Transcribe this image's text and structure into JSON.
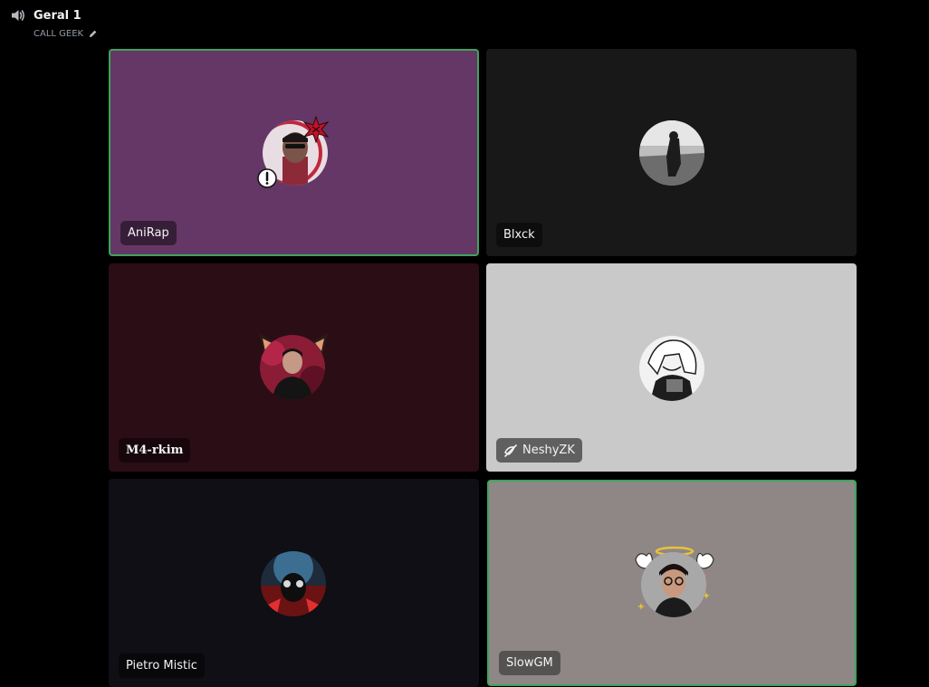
{
  "channel": {
    "name": "Geral 1",
    "subtitle": "CALL GEEK",
    "speaker_icon": "speaker-icon",
    "edit_icon": "pencil-icon"
  },
  "tiles": [
    {
      "name": "AniRap",
      "background": "#653766",
      "speaking": true
    },
    {
      "name": "Blxck",
      "background": "#181818",
      "speaking": false
    },
    {
      "name": "M4-rkim",
      "background": "#2b0d16",
      "speaking": false
    },
    {
      "name": "NeshyZK",
      "background": "#c9c9c9",
      "speaking": false,
      "icon": "stream-off-icon"
    },
    {
      "name": "Pietro Mistic",
      "background": "#0f0f15",
      "speaking": false
    },
    {
      "name": "SlowGM",
      "background": "#8f8786",
      "speaking": true
    }
  ],
  "colors": {
    "speaking_border": "#3ba55c"
  }
}
